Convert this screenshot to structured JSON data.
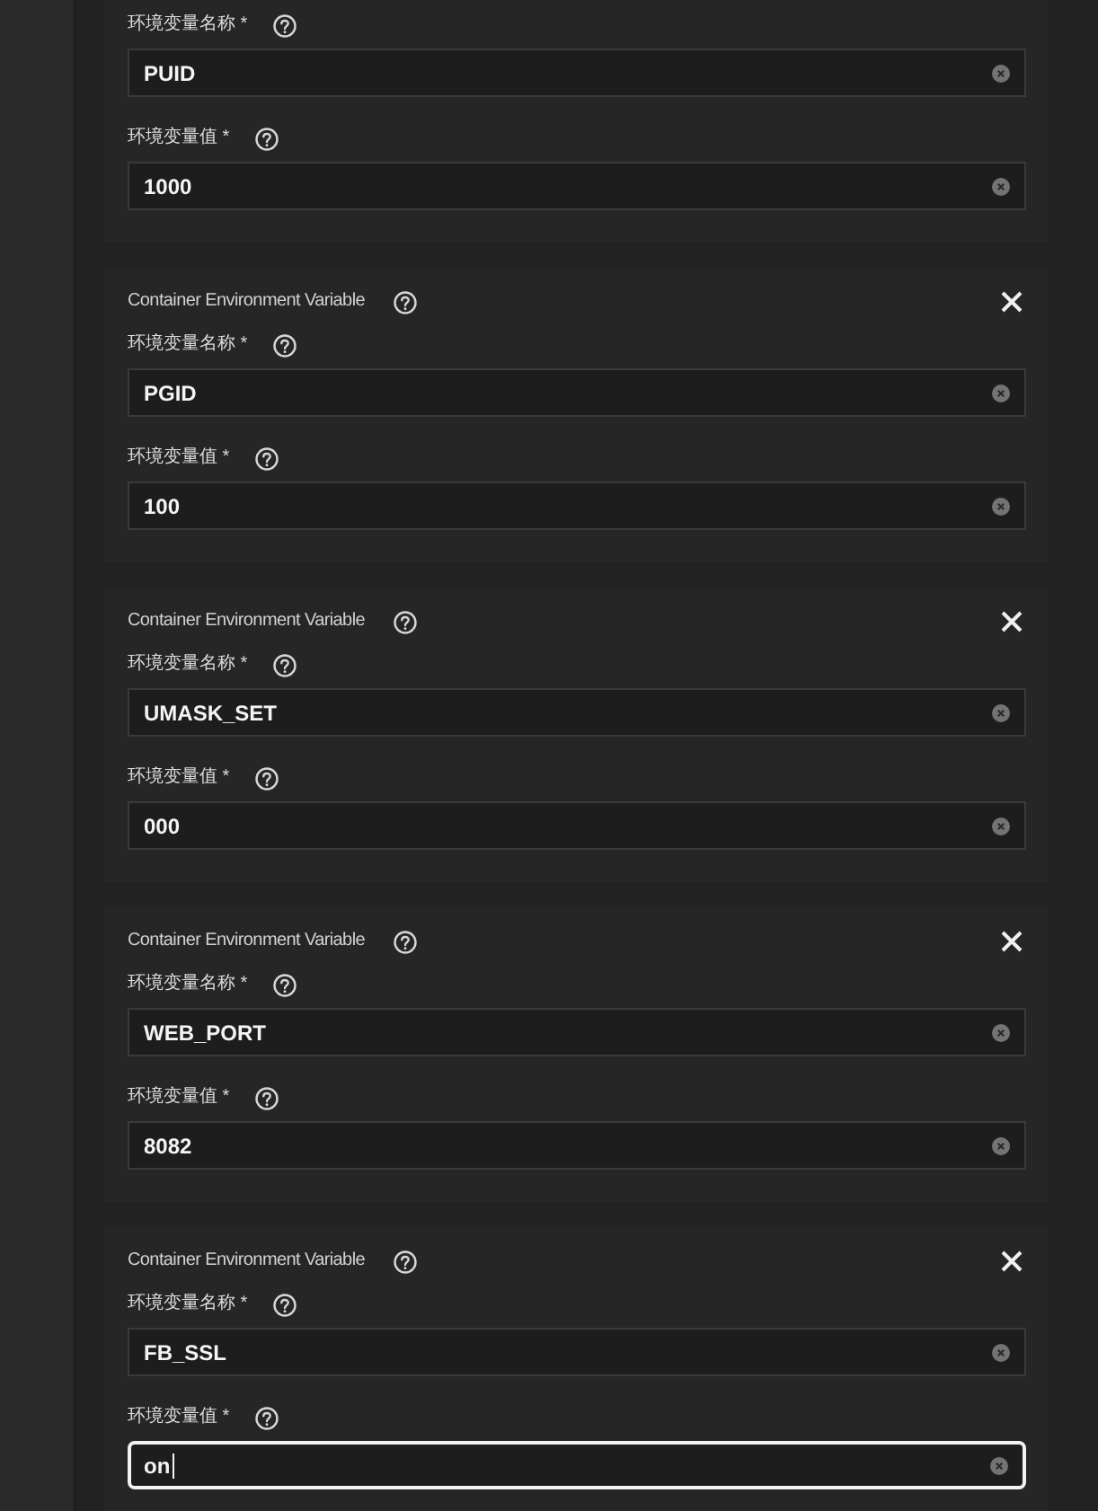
{
  "cards": [
    {
      "fields": [
        {
          "label": "环境变量名称 *",
          "value": "PUID",
          "focused": false
        },
        {
          "label": "环境变量值 *",
          "value": "1000",
          "focused": false
        }
      ]
    },
    {
      "title": "Container Environment Variable",
      "fields": [
        {
          "label": "环境变量名称 *",
          "value": "PGID",
          "focused": false
        },
        {
          "label": "环境变量值 *",
          "value": "100",
          "focused": false
        }
      ]
    },
    {
      "title": "Container Environment Variable",
      "fields": [
        {
          "label": "环境变量名称 *",
          "value": "UMASK_SET",
          "focused": false
        },
        {
          "label": "环境变量值 *",
          "value": "000",
          "focused": false
        }
      ]
    },
    {
      "title": "Container Environment Variable",
      "fields": [
        {
          "label": "环境变量名称 *",
          "value": "WEB_PORT",
          "focused": false
        },
        {
          "label": "环境变量值 *",
          "value": "8082",
          "focused": false
        }
      ]
    },
    {
      "title": "Container Environment Variable",
      "fields": [
        {
          "label": "环境变量名称 *",
          "value": "FB_SSL",
          "focused": false
        },
        {
          "label": "环境变量值 *",
          "value": "on",
          "focused": true
        }
      ]
    }
  ]
}
